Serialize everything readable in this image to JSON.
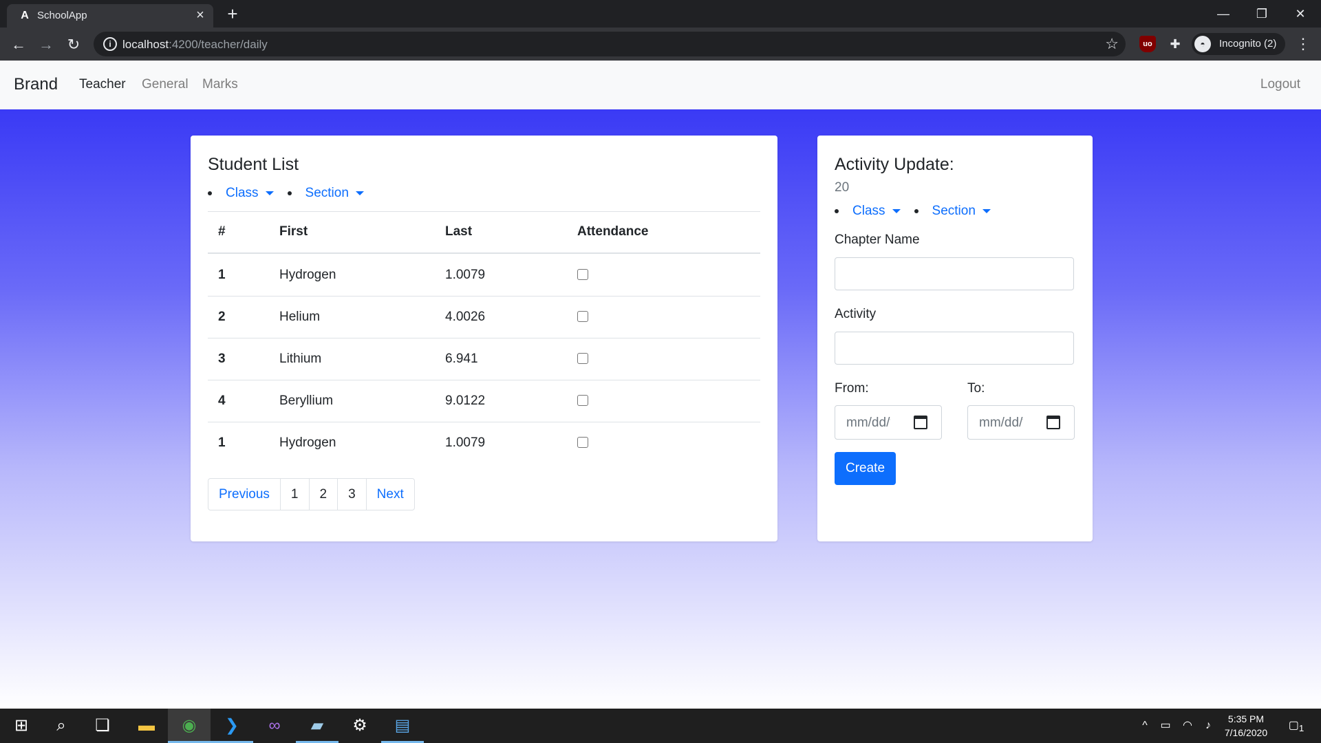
{
  "browser": {
    "tab_title": "SchoolApp",
    "tab_favicon": "A",
    "url_host": "localhost",
    "url_path": ":4200/teacher/daily",
    "incognito_label": "Incognito (2)",
    "icons": [
      "back-icon",
      "forward-icon",
      "reload-icon",
      "info-icon",
      "star-icon",
      "ublock-icon",
      "extensions-icon",
      "incognito-icon",
      "menu-icon"
    ]
  },
  "navbar": {
    "brand": "Brand",
    "links": [
      "Teacher",
      "General",
      "Marks"
    ],
    "logout": "Logout"
  },
  "student_list": {
    "title": "Student List",
    "dropdowns": [
      "Class",
      "Section"
    ],
    "columns": [
      "#",
      "First",
      "Last",
      "Attendance"
    ],
    "rows": [
      {
        "num": "1",
        "first": "Hydrogen",
        "last": "1.0079",
        "attended": false
      },
      {
        "num": "2",
        "first": "Helium",
        "last": "4.0026",
        "attended": false
      },
      {
        "num": "3",
        "first": "Lithium",
        "last": "6.941",
        "attended": false
      },
      {
        "num": "4",
        "first": "Beryllium",
        "last": "9.0122",
        "attended": false
      },
      {
        "num": "1",
        "first": "Hydrogen",
        "last": "1.0079",
        "attended": false
      }
    ],
    "pagination": [
      "Previous",
      "1",
      "2",
      "3",
      "Next"
    ]
  },
  "activity": {
    "title": "Activity Update:",
    "count": "20",
    "dropdowns": [
      "Class",
      "Section"
    ],
    "chapter_label": "Chapter Name",
    "chapter_value": "",
    "activity_label": "Activity",
    "activity_value": "",
    "from_label": "From:",
    "to_label": "To:",
    "date_placeholder": "mm/dd/yyyy",
    "create_label": "Create"
  },
  "taskbar": {
    "time": "5:35 PM",
    "date": "7/16/2020",
    "notification_count": "1"
  },
  "colors": {
    "link": "#0d6efd",
    "gradient_top": "#3a3af5",
    "primary_button": "#0d6efd"
  }
}
